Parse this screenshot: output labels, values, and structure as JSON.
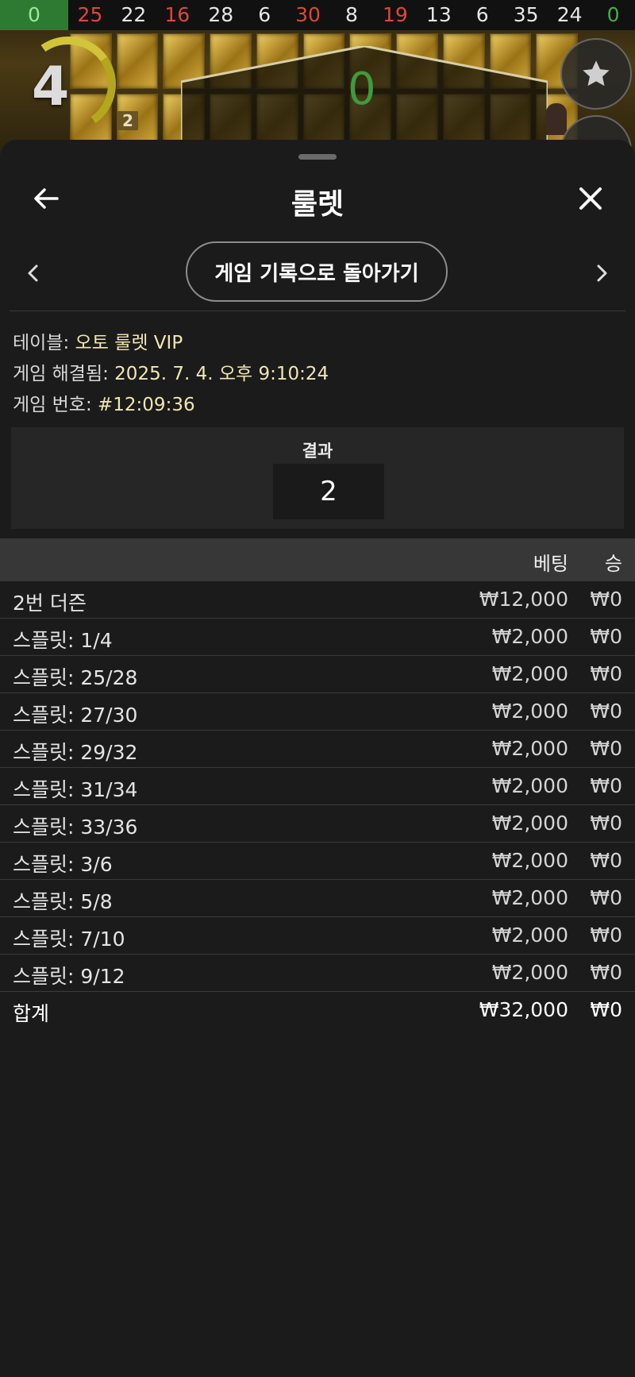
{
  "game_background": {
    "history_numbers": [
      {
        "value": "0",
        "color": "green"
      },
      {
        "value": "25",
        "color": "red"
      },
      {
        "value": "22",
        "color": "white"
      },
      {
        "value": "16",
        "color": "red"
      },
      {
        "value": "28",
        "color": "white"
      },
      {
        "value": "6",
        "color": "white"
      },
      {
        "value": "30",
        "color": "red"
      },
      {
        "value": "8",
        "color": "white"
      },
      {
        "value": "19",
        "color": "red"
      },
      {
        "value": "13",
        "color": "white"
      },
      {
        "value": "6",
        "color": "white"
      },
      {
        "value": "35",
        "color": "white"
      },
      {
        "value": "24",
        "color": "white"
      },
      {
        "value": "0",
        "color": "green-text"
      }
    ],
    "timer_value": "4",
    "tile_label": "2",
    "result_display": "0"
  },
  "sheet": {
    "title": "룰렛",
    "back_history_label": "게임 기록으로 돌아가기",
    "info": {
      "table_label": "테이블: ",
      "table_value": "오토 룰렛 VIP",
      "resolved_label": "게임 해결됨: ",
      "resolved_value": "2025. 7. 4. 오후 9:10:24",
      "game_no_label": "게임 번호: ",
      "game_no_value": "#12:09:36"
    },
    "result": {
      "title": "결과",
      "number": "2"
    },
    "bets_header": {
      "bet": "베팅",
      "win": "승"
    },
    "bets": [
      {
        "name": "2번 더즌",
        "bet": "₩12,000",
        "win": "₩0"
      },
      {
        "name": "스플릿: 1/4",
        "bet": "₩2,000",
        "win": "₩0"
      },
      {
        "name": "스플릿: 25/28",
        "bet": "₩2,000",
        "win": "₩0"
      },
      {
        "name": "스플릿: 27/30",
        "bet": "₩2,000",
        "win": "₩0"
      },
      {
        "name": "스플릿: 29/32",
        "bet": "₩2,000",
        "win": "₩0"
      },
      {
        "name": "스플릿: 31/34",
        "bet": "₩2,000",
        "win": "₩0"
      },
      {
        "name": "스플릿: 33/36",
        "bet": "₩2,000",
        "win": "₩0"
      },
      {
        "name": "스플릿: 3/6",
        "bet": "₩2,000",
        "win": "₩0"
      },
      {
        "name": "스플릿: 5/8",
        "bet": "₩2,000",
        "win": "₩0"
      },
      {
        "name": "스플릿: 7/10",
        "bet": "₩2,000",
        "win": "₩0"
      },
      {
        "name": "스플릿: 9/12",
        "bet": "₩2,000",
        "win": "₩0"
      }
    ],
    "total": {
      "name": "합계",
      "bet": "₩32,000",
      "win": "₩0"
    }
  },
  "colors": {
    "sheet_bg": "#1b1b1b",
    "info_value": "#f2e6b3",
    "history_red": "#e0453a",
    "history_green": "#2f7a32"
  }
}
